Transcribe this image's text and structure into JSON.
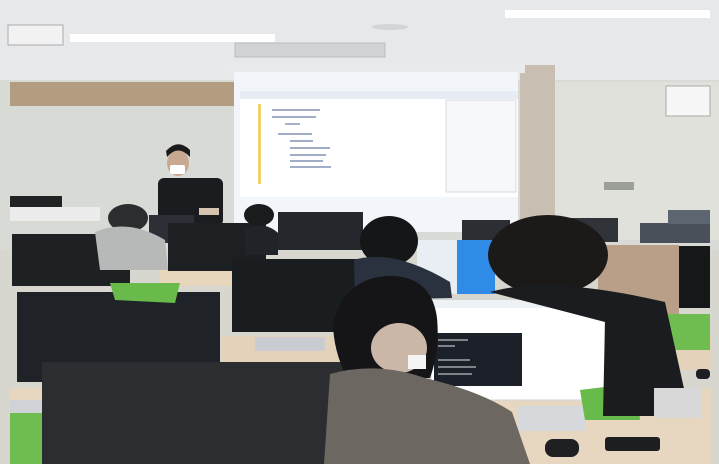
{
  "scene": {
    "description_colors": {
      "ceiling": "#e7e9ea",
      "wall": "#d9dbd8",
      "wood_band": "#b59f86",
      "screen": "#f3f6fa",
      "desk": "#e6d6bf",
      "monitor": "#1e2124",
      "chair": "#6bbf4a",
      "code_bg": "#1b1f2a"
    }
  }
}
